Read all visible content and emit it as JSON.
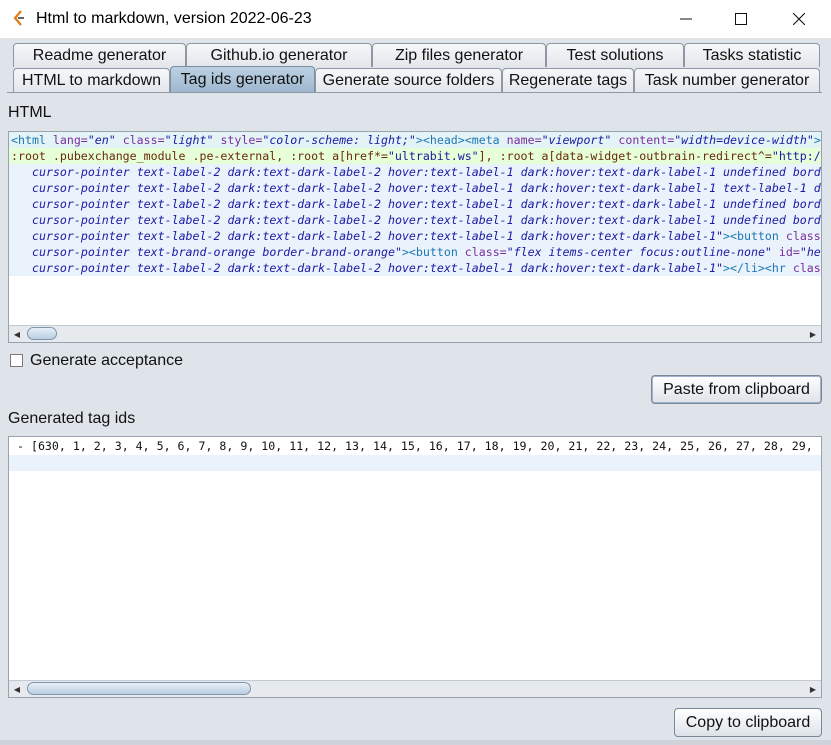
{
  "window": {
    "title": "Html to markdown, version 2022-06-23",
    "controls": [
      "minimize",
      "maximize",
      "close"
    ]
  },
  "tabs": {
    "row1": [
      "Readme generator",
      "Github.io generator",
      "Zip files generator",
      "Test solutions",
      "Tasks statistic"
    ],
    "row2": [
      "HTML to markdown",
      "Tag ids generator",
      "Generate source folders",
      "Regenerate tags",
      "Task number generator"
    ],
    "selected": "Tag ids generator"
  },
  "html_section": {
    "label": "HTML",
    "lines": [
      {
        "style": "hl1",
        "indent": 0,
        "tokens": [
          {
            "t": "tag",
            "v": "<html "
          },
          {
            "t": "attr",
            "v": "lang="
          },
          {
            "t": "val",
            "v": "\"en\""
          },
          {
            "t": "attr",
            "v": " class="
          },
          {
            "t": "val",
            "v": "\"light\""
          },
          {
            "t": "attr",
            "v": " style="
          },
          {
            "t": "val",
            "v": "\"color-scheme: light;\""
          },
          {
            "t": "tag",
            "v": "><head><meta "
          },
          {
            "t": "attr",
            "v": "name="
          },
          {
            "t": "val",
            "v": "\"viewport\""
          },
          {
            "t": "attr",
            "v": " content="
          },
          {
            "t": "val",
            "v": "\"width=device-width\""
          },
          {
            "t": "tag",
            "v": ">"
          }
        ]
      },
      {
        "style": "hl2",
        "indent": 0,
        "tokens": [
          {
            "t": "css",
            "v": ":root .pubexchange_module .pe-external, :root a[href*="
          },
          {
            "t": "str",
            "v": "\"ultrabit.ws\""
          },
          {
            "t": "css",
            "v": "], :root a[data-widget-outbrain-redirect^="
          },
          {
            "t": "str",
            "v": "\"http:/"
          }
        ]
      },
      {
        "style": "hl3",
        "indent": 1,
        "tokens": [
          {
            "t": "val",
            "v": "cursor-pointer text-label-2 dark:text-dark-label-2 hover:text-label-1 dark:hover:text-dark-label-1 undefined bord"
          }
        ]
      },
      {
        "style": "hl3",
        "indent": 1,
        "tokens": [
          {
            "t": "val",
            "v": "cursor-pointer text-label-2 dark:text-dark-label-2 hover:text-label-1 dark:hover:text-dark-label-1 text-label-1 d"
          }
        ]
      },
      {
        "style": "hl3",
        "indent": 1,
        "tokens": [
          {
            "t": "val",
            "v": "cursor-pointer text-label-2 dark:text-dark-label-2 hover:text-label-1 dark:hover:text-dark-label-1 undefined bord"
          }
        ]
      },
      {
        "style": "hl3",
        "indent": 1,
        "tokens": [
          {
            "t": "val",
            "v": "cursor-pointer text-label-2 dark:text-dark-label-2 hover:text-label-1 dark:hover:text-dark-label-1 undefined bord"
          }
        ]
      },
      {
        "style": "hl3",
        "indent": 1,
        "tokens": [
          {
            "t": "val",
            "v": "cursor-pointer text-label-2 dark:text-dark-label-2 hover:text-label-1 dark:hover:text-dark-label-1\""
          },
          {
            "t": "tag",
            "v": "><button "
          },
          {
            "t": "attr",
            "v": "class"
          }
        ]
      },
      {
        "style": "hl3",
        "indent": 1,
        "tokens": [
          {
            "t": "val",
            "v": "cursor-pointer text-brand-orange border-brand-orange\""
          },
          {
            "t": "tag",
            "v": "><button "
          },
          {
            "t": "attr",
            "v": "class="
          },
          {
            "t": "val",
            "v": "\"flex items-center focus:outline-none\""
          },
          {
            "t": "attr",
            "v": " id="
          },
          {
            "t": "val",
            "v": "\"he"
          }
        ]
      },
      {
        "style": "hl3",
        "indent": 1,
        "tokens": [
          {
            "t": "val",
            "v": "cursor-pointer text-label-2 dark:text-dark-label-2 hover:text-label-1 dark:hover:text-dark-label-1\""
          },
          {
            "t": "tag",
            "v": "></li><hr "
          },
          {
            "t": "attr",
            "v": "clas"
          }
        ]
      }
    ]
  },
  "acceptance": {
    "label": "Generate acceptance",
    "checked": false
  },
  "paste_button": "Paste from clipboard",
  "output_section": {
    "label": "Generated tag ids",
    "lines": [
      "- [630, 1, 2, 3, 4, 5, 6, 7, 8, 9, 10, 11, 12, 13, 14, 15, 16, 17, 18, 19, 20, 21, 22, 23, 24, 25, 26, 27, 28, 29,"
    ]
  },
  "copy_button": "Copy to clipboard"
}
